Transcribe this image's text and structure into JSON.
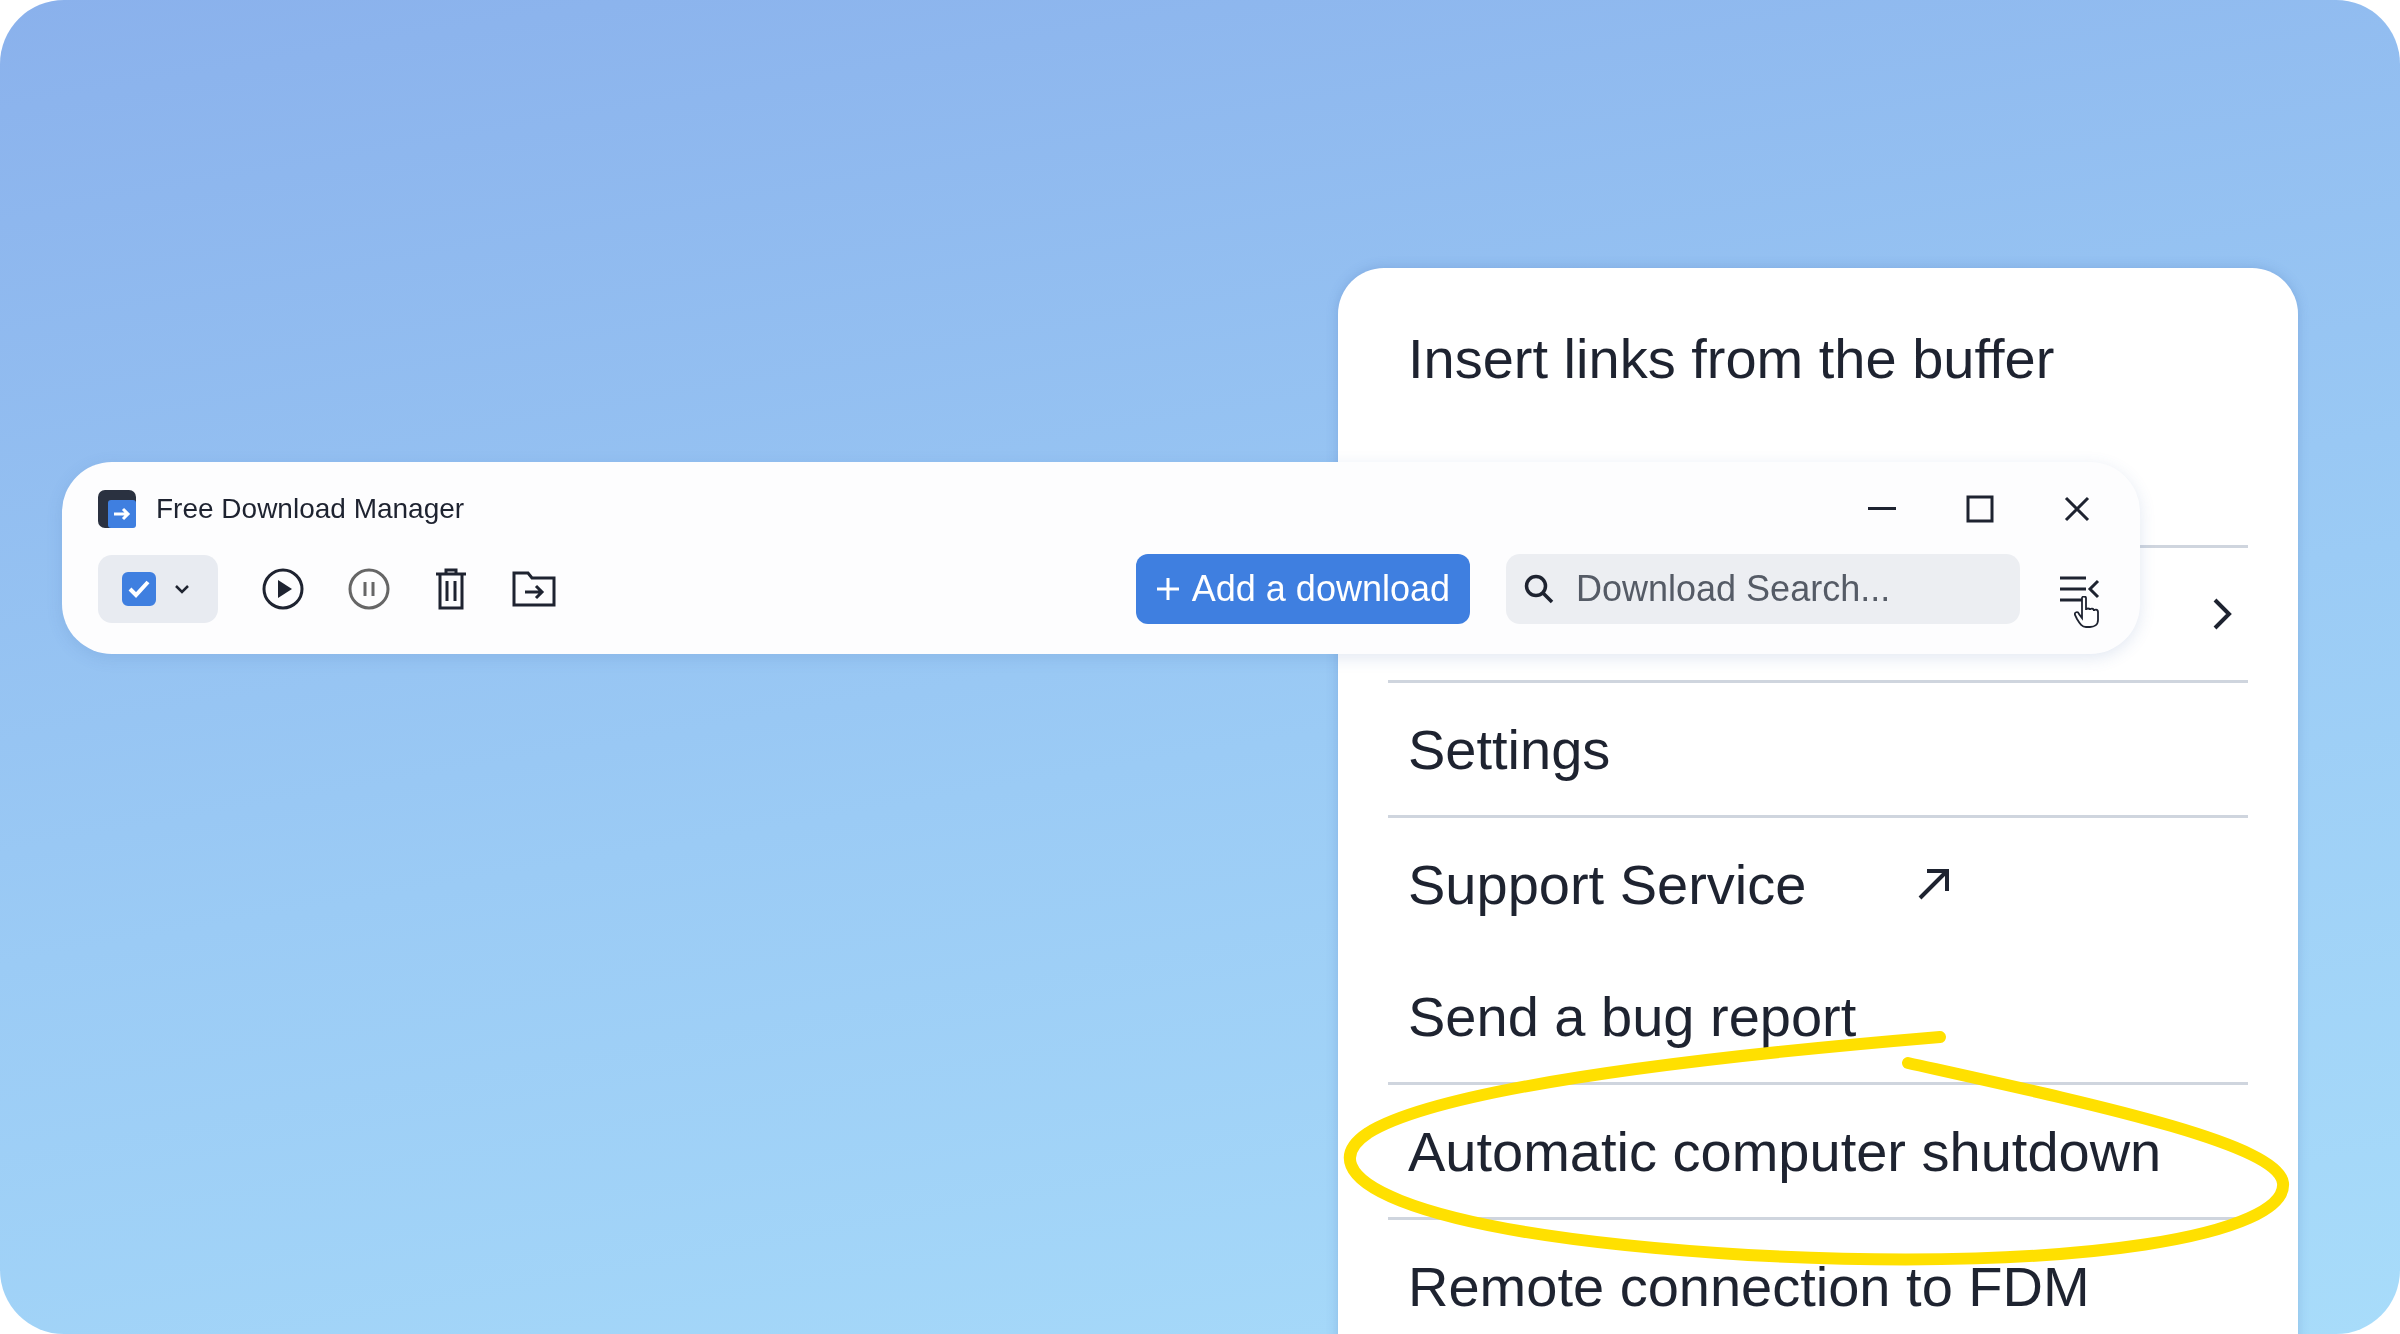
{
  "window": {
    "title": "Free Download Manager"
  },
  "toolbar": {
    "select_all": {
      "checked": true
    },
    "add_button": "Add a download",
    "search": {
      "placeholder": "Download Search..."
    }
  },
  "menu": {
    "items": [
      {
        "kind": "item",
        "label": "Insert links from the buffer",
        "highlighted": false
      },
      {
        "kind": "divider"
      },
      {
        "kind": "submenu"
      },
      {
        "kind": "divider"
      },
      {
        "kind": "item",
        "label": "Settings",
        "highlighted": false
      },
      {
        "kind": "divider"
      },
      {
        "kind": "external",
        "label": "Support Service",
        "highlighted": false
      },
      {
        "kind": "item",
        "label": "Send a bug report",
        "highlighted": false
      },
      {
        "kind": "divider"
      },
      {
        "kind": "item",
        "label": "Automatic computer shutdown",
        "highlighted": true
      },
      {
        "kind": "divider"
      },
      {
        "kind": "item",
        "label": "Remote connection to FDM",
        "highlighted": false
      }
    ]
  }
}
